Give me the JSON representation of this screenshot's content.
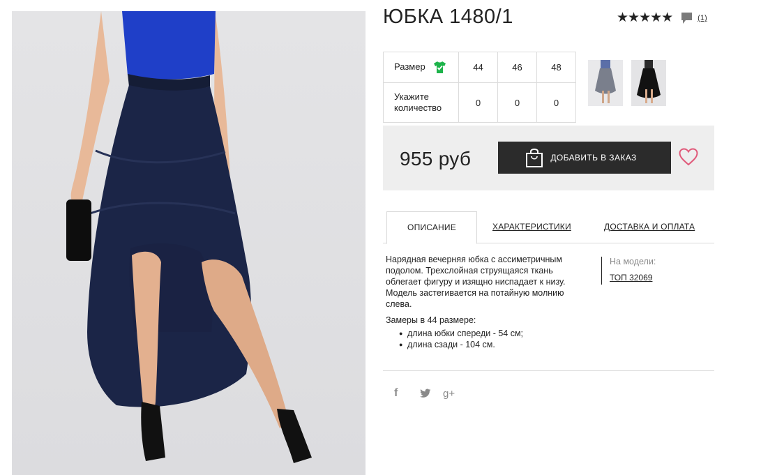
{
  "product": {
    "title": "ЮБКА 1480/1",
    "stars": "★★★★★",
    "review_count": "(1)"
  },
  "sizes": {
    "size_label": "Размер",
    "quantity_label": "Укажите количество",
    "columns": [
      {
        "size": "44",
        "qty": "0"
      },
      {
        "size": "46",
        "qty": "0"
      },
      {
        "size": "48",
        "qty": "0"
      }
    ]
  },
  "thumbnails": [
    "skirt-grey-thumbnail",
    "skirt-black-thumbnail"
  ],
  "purchase": {
    "price": "955 руб",
    "order_button": "ДОБАВИТЬ В ЗАКАЗ",
    "accent_color": "#e05a7a"
  },
  "tabs": [
    {
      "label": "ОПИСАНИЕ",
      "active": true
    },
    {
      "label": "ХАРАКТЕРИСТИКИ",
      "active": false
    },
    {
      "label": "ДОСТАВКА И ОПЛАТА",
      "active": false
    }
  ],
  "description": {
    "text": "Нарядная вечерняя юбка с ассиметричным подолом. Трехслойная струящаяся ткань облегает фигуру и изящно ниспадает к низу. Модель застегивается на потайную молнию слева.",
    "measure_title": "Замеры в 44 размере:",
    "measures": [
      "длина юбки спереди - 54 см;",
      "длина сзади - 104 см."
    ]
  },
  "model": {
    "label": "На модели:",
    "link": "ТОП 32069"
  },
  "social": {
    "facebook": "f",
    "twitter": "twitter-icon",
    "googleplus": "g+"
  }
}
